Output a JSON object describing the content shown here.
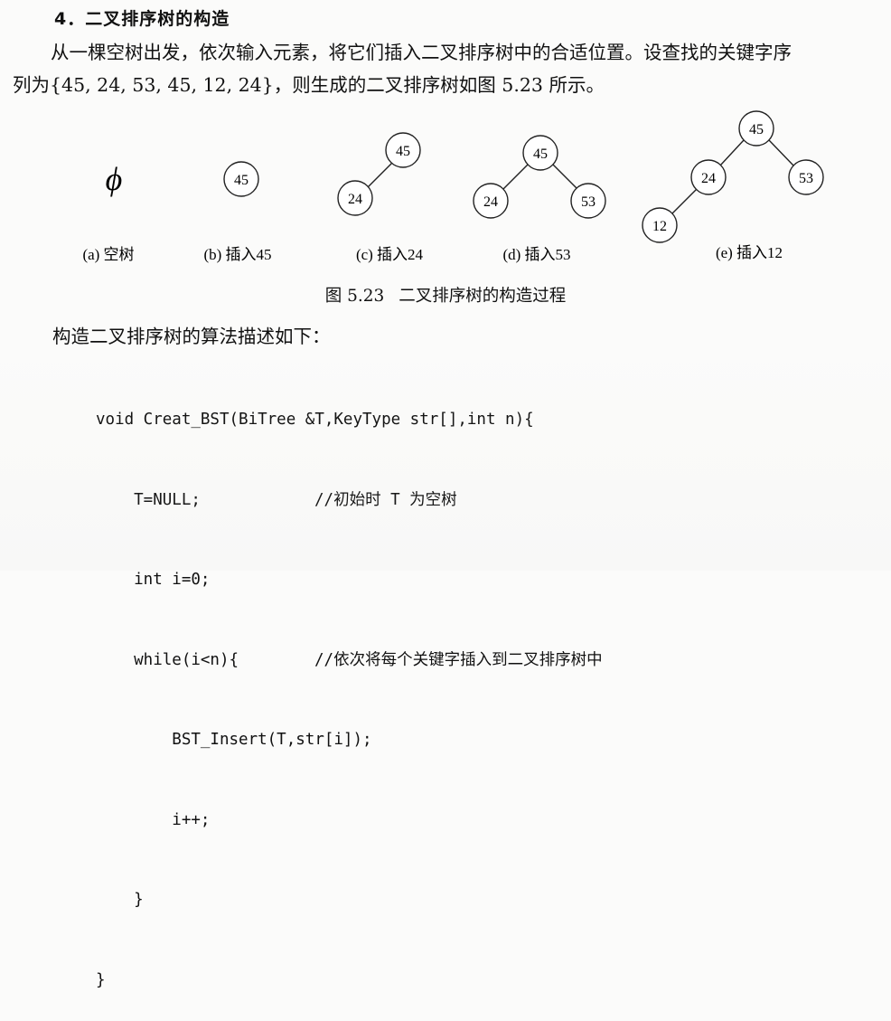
{
  "section": {
    "heading": "4．二叉排序树的构造"
  },
  "paragraph": {
    "line1": "从一棵空树出发，依次输入元素，将它们插入二叉排序树中的合适位置。设查找的关键字序",
    "line2": "列为{45, 24, 53, 45, 12, 24}，则生成的二叉排序树如图 5.23 所示。"
  },
  "figure": {
    "number": "图 5.23",
    "title": "二叉排序树的构造过程",
    "empty_symbol": "ϕ",
    "panels": [
      {
        "label": "(a)  空树",
        "nodes": []
      },
      {
        "label": "(b)  插入45",
        "nodes": [
          "45"
        ]
      },
      {
        "label": "(c)  插入24",
        "nodes": [
          "45",
          "24"
        ]
      },
      {
        "label": "(d)  插入53",
        "nodes": [
          "45",
          "24",
          "53"
        ]
      },
      {
        "label": "(e)  插入12",
        "nodes": [
          "45",
          "24",
          "53",
          "12"
        ]
      }
    ]
  },
  "algorithm": {
    "intro": "构造二叉排序树的算法描述如下：",
    "code": [
      {
        "text": "void Creat_BST(BiTree &T,KeyType str[],int n){",
        "comment": ""
      },
      {
        "text": "    T=NULL;",
        "comment": "//初始时 T 为空树"
      },
      {
        "text": "    int i=0;",
        "comment": ""
      },
      {
        "text": "    while(i<n){",
        "comment": "//依次将每个关键字插入到二叉排序树中"
      },
      {
        "text": "        BST_Insert(T,str[i]);",
        "comment": ""
      },
      {
        "text": "        i++;",
        "comment": ""
      },
      {
        "text": "    }",
        "comment": ""
      },
      {
        "text": "}",
        "comment": ""
      }
    ]
  }
}
